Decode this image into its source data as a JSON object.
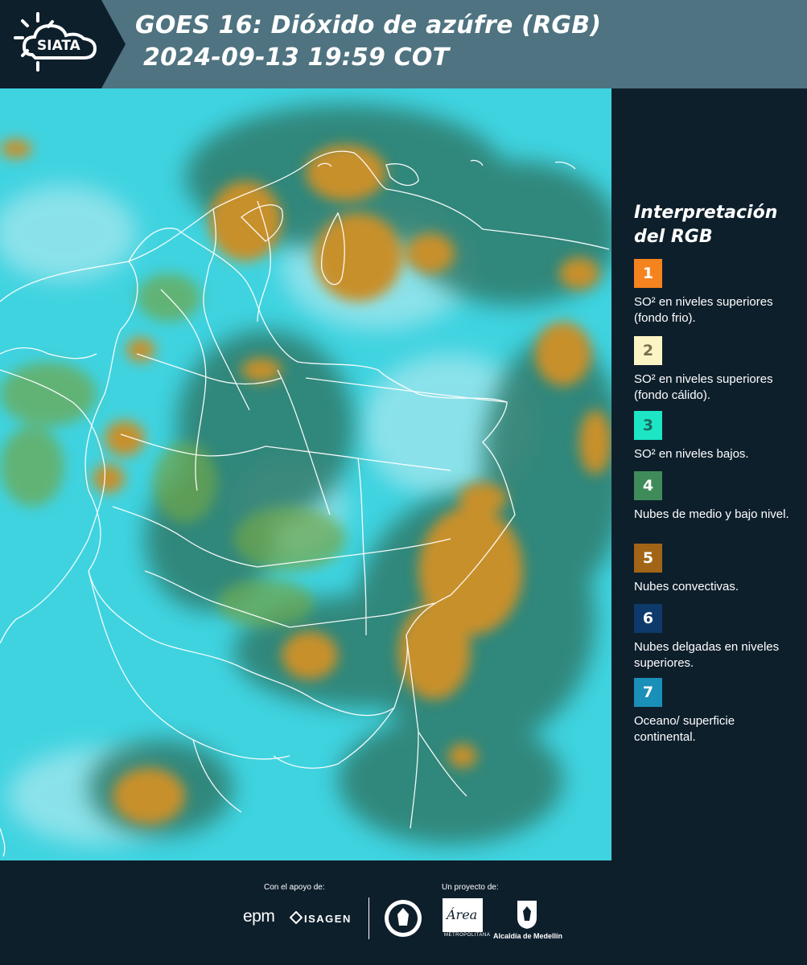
{
  "header": {
    "brand": "SIATA",
    "title_line1": "GOES 16: Dióxido de azúfre (RGB)",
    "title_line2": "2024-09-13 19:59 COT"
  },
  "map": {
    "description_icon": "satellite-map",
    "background_color": "#3fd3e0",
    "border_color": "#ffffff"
  },
  "legend": {
    "title": "Interpretación del RGB",
    "items": [
      {
        "number": "1",
        "color": "#f5841f",
        "text_color": "#ffffff",
        "label": "SO² en niveles superiores (fondo frio)."
      },
      {
        "number": "2",
        "color": "#fbf5c6",
        "text_color": "#7a6f4a",
        "label": "SO² en niveles superiores (fondo cálido)."
      },
      {
        "number": "3",
        "color": "#1ce6c3",
        "text_color": "#1a6c60",
        "label": "SO² en niveles bajos."
      },
      {
        "number": "4",
        "color": "#3f8c5a",
        "text_color": "#ffffff",
        "label": "Nubes de medio y bajo nivel."
      },
      {
        "number": "5",
        "color": "#a26416",
        "text_color": "#ffffff",
        "label": "Nubes convectivas."
      },
      {
        "number": "6",
        "color": "#0d3a6a",
        "text_color": "#ffffff",
        "label": "Nubes delgadas en niveles superiores."
      },
      {
        "number": "7",
        "color": "#1a8fb8",
        "text_color": "#ffffff",
        "label": "Oceano/ superficie continental."
      }
    ]
  },
  "footer": {
    "support_label": "Con el apoyo de:",
    "project_label": "Un proyecto de:",
    "epm": "epm",
    "isagen": "ISAGEN",
    "area_wordmark": "Área",
    "area_sub": "METROPOLITANA",
    "alcaldia": "Alcaldía de Medellín"
  }
}
